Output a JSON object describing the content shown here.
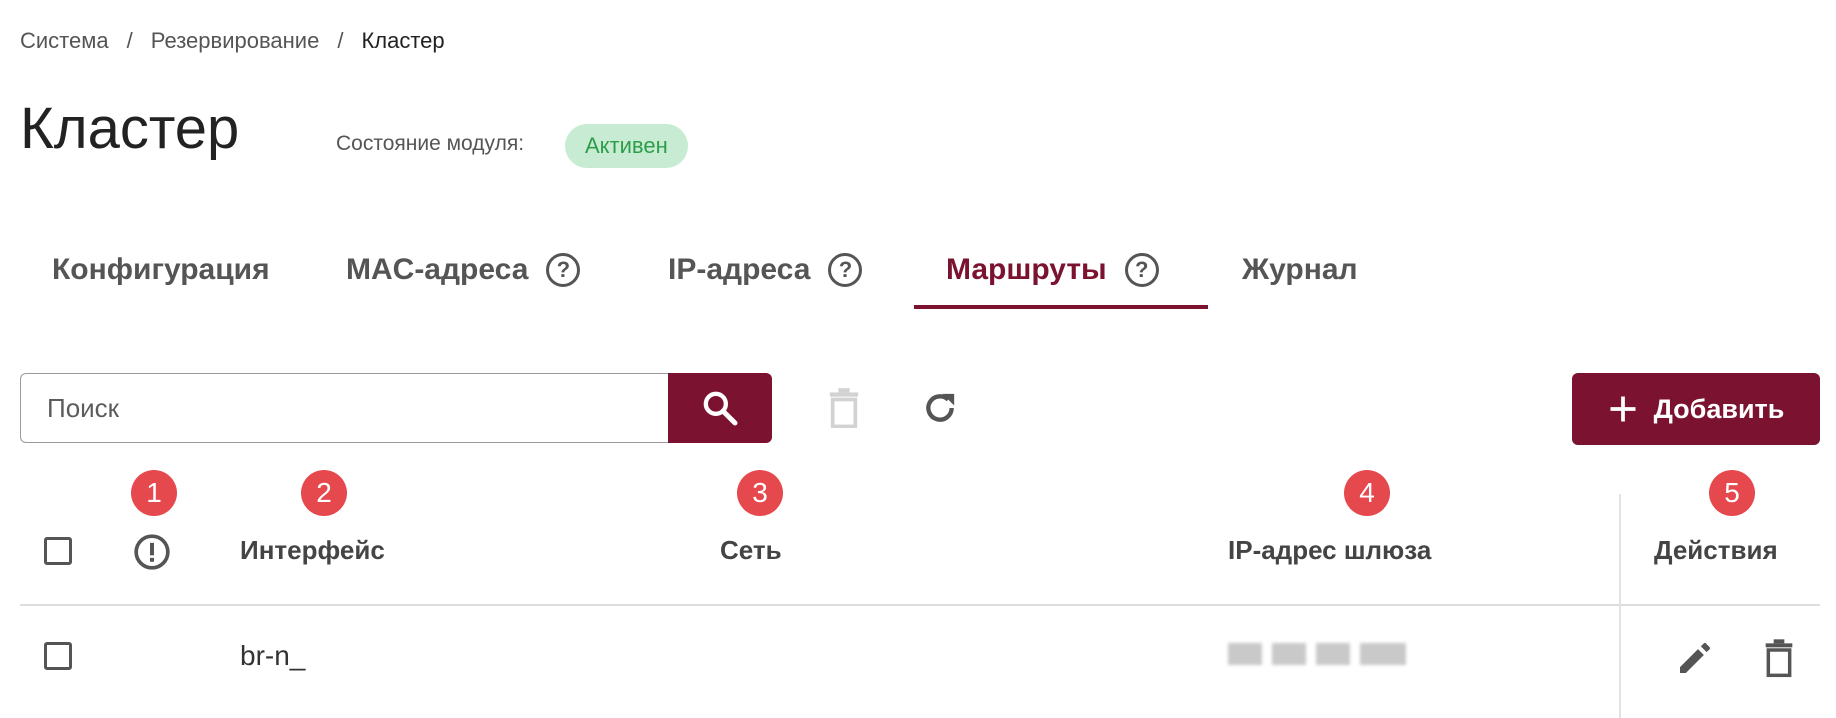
{
  "breadcrumb": {
    "items": [
      "Система",
      "Резервирование",
      "Кластер"
    ],
    "separator": "/"
  },
  "page": {
    "title": "Кластер",
    "module_state_label": "Состояние модуля:",
    "module_state_value": "Активен"
  },
  "tabs": [
    {
      "label": "Конфигурация",
      "help": false,
      "active": false
    },
    {
      "label": "MAC-адреса",
      "help": true,
      "active": false
    },
    {
      "label": "IP-адреса",
      "help": true,
      "active": false
    },
    {
      "label": "Маршруты",
      "help": true,
      "active": true
    },
    {
      "label": "Журнал",
      "help": false,
      "active": false
    }
  ],
  "toolbar": {
    "search_placeholder": "Поиск",
    "search_icon": "search-icon",
    "delete_icon": "trash-icon",
    "refresh_icon": "refresh-icon",
    "add_label": "Добавить"
  },
  "annotations": [
    "1",
    "2",
    "3",
    "4",
    "5"
  ],
  "table": {
    "columns": [
      "Интерфейс",
      "Сеть",
      "IP-адрес шлюза",
      "Действия"
    ],
    "status_column_icon": "exclamation-circle-icon",
    "rows": [
      {
        "interface": "br-n_",
        "network": "",
        "gateway": "",
        "actions": [
          "edit-icon",
          "trash-icon"
        ]
      }
    ]
  },
  "colors": {
    "accent": "#7a1230",
    "status_badge_bg": "#c8ecd3",
    "status_badge_text": "#2e9e4a",
    "annotation_badge": "#e5484d"
  }
}
